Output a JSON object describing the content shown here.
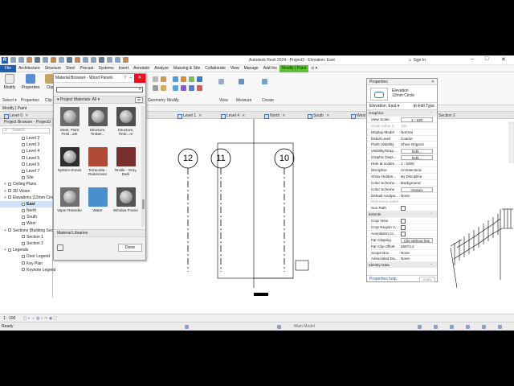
{
  "title_bar": {
    "app_title": "Autodesk Revit 2024 - Project3 - Elevation: East",
    "sign_in": "Sign In",
    "logo": "R"
  },
  "menu": {
    "tabs": [
      "File",
      "Architecture",
      "Structure",
      "Steel",
      "Precast",
      "Systems",
      "Insert",
      "Annotate",
      "Analyze",
      "Massing & Site",
      "Collaborate",
      "View",
      "Manage",
      "Add-Ins",
      "Modify | Paint"
    ]
  },
  "ribbon": {
    "modify_label": "Modify",
    "properties_label": "Properties",
    "select_label": "Select ▾",
    "clip_label": "Clip",
    "geometry_label": "Geometry",
    "panel_modify": "Modify",
    "panel_view": "View",
    "panel_measure": "Measure",
    "panel_create": "Create"
  },
  "modify_bar": "Modify | Paint",
  "view_tabs": [
    "Level 0",
    "Level 1",
    "Level 4",
    "North",
    "South",
    "West",
    "Section 2"
  ],
  "project_browser": {
    "title": "Project Browser - Project3",
    "search_placeholder": "Search",
    "items": [
      {
        "label": "Level 2",
        "type": "leaf"
      },
      {
        "label": "Level 3",
        "type": "leaf"
      },
      {
        "label": "Level 4",
        "type": "leaf"
      },
      {
        "label": "Level 5",
        "type": "leaf"
      },
      {
        "label": "Level 6",
        "type": "leaf"
      },
      {
        "label": "Level 7",
        "type": "leaf"
      },
      {
        "label": "Site",
        "type": "leaf"
      },
      {
        "label": "Ceiling Plans",
        "type": "group"
      },
      {
        "label": "3D Views",
        "type": "group"
      },
      {
        "label": "Elevations (12mm Circle)",
        "type": "group"
      },
      {
        "label": "East",
        "type": "leaf",
        "selected": true
      },
      {
        "label": "North",
        "type": "leaf"
      },
      {
        "label": "South",
        "type": "leaf"
      },
      {
        "label": "West",
        "type": "leaf"
      },
      {
        "label": "Sections (Building Section)",
        "type": "group"
      },
      {
        "label": "Section 1",
        "type": "leaf"
      },
      {
        "label": "Section 2",
        "type": "leaf"
      },
      {
        "label": "Legends",
        "type": "group"
      },
      {
        "label": "Door Legend",
        "type": "leaf"
      },
      {
        "label": "Key Plan",
        "type": "leaf"
      },
      {
        "label": "Keynote Legend",
        "type": "leaf"
      }
    ]
  },
  "material_browser": {
    "title": "Material Browser - Wood Panels",
    "help": "?",
    "search_value": "",
    "section_header": "Project Materials: All",
    "materials": [
      {
        "label": "Steel, Paint Finis...ark",
        "color": "#6a6a6a",
        "sphere": true
      },
      {
        "label": "Structure, Timber...",
        "color": "#5a5a5a",
        "sphere": true
      },
      {
        "label": "Structure, Timb...re",
        "color": "#4e4e4e",
        "sphere": true
      },
      {
        "label": "System-Zones",
        "color": "#2e2e2e",
        "sphere": true
      },
      {
        "label": "Terracotta - Rainscreen",
        "color": "#b04a34",
        "sphere": false
      },
      {
        "label": "Textile - Grey, Dark",
        "color": "#7a2f2f",
        "sphere": false
      },
      {
        "label": "Vapor Retarder",
        "color": "#707070",
        "sphere": true
      },
      {
        "label": "Water",
        "color": "#4a8fcc",
        "sphere": false
      },
      {
        "label": "Window Frame",
        "color": "#555555",
        "sphere": true
      },
      {
        "label": "",
        "color": "#d2a865",
        "sphere": false
      },
      {
        "label": "",
        "color": "#b98f5e",
        "sphere": false
      },
      {
        "label": "",
        "color": "#c9a46e",
        "sphere": false
      }
    ],
    "libraries_label": "Material Libraries",
    "done_label": "Done",
    "scroll_position": 0.85
  },
  "drawing": {
    "grid_labels": [
      "12",
      "11",
      "10"
    ]
  },
  "properties": {
    "title": "Properties",
    "type_name_line1": "Elevation",
    "type_name_line2": "12mm Circle",
    "selector": "Elevation: East",
    "edit_type": "Edit Type",
    "rows": [
      {
        "k": "Graphics",
        "v": "",
        "kind": "cat"
      },
      {
        "k": "View Scale",
        "v": "1 : 100",
        "kind": "box"
      },
      {
        "k": "Scale Value    1:",
        "v": "100",
        "kind": "grey"
      },
      {
        "k": "Display Model",
        "v": "Normal",
        "kind": "text"
      },
      {
        "k": "Detail Level",
        "v": "Coarse",
        "kind": "text"
      },
      {
        "k": "Parts Visibility",
        "v": "Show Original",
        "kind": "text"
      },
      {
        "k": "Visibility/Grap...",
        "v": "Edit...",
        "kind": "box"
      },
      {
        "k": "Graphic Displ...",
        "v": "Edit...",
        "kind": "box"
      },
      {
        "k": "Hide at scales ...",
        "v": "1 : 5000",
        "kind": "text"
      },
      {
        "k": "Discipline",
        "v": "Architectural",
        "kind": "text"
      },
      {
        "k": "Show Hidden...",
        "v": "By Discipline",
        "kind": "text"
      },
      {
        "k": "Color Scheme...",
        "v": "Background",
        "kind": "text"
      },
      {
        "k": "Color Scheme",
        "v": "<none>",
        "kind": "box"
      },
      {
        "k": "Default Analysi...",
        "v": "None",
        "kind": "text"
      },
      {
        "k": "Reference Label",
        "v": "",
        "kind": "grey"
      },
      {
        "k": "Sun Path",
        "v": "",
        "kind": "chk"
      },
      {
        "k": "Extents",
        "v": "",
        "kind": "cat"
      },
      {
        "k": "Crop View",
        "v": "",
        "kind": "chk"
      },
      {
        "k": "Crop Region V...",
        "v": "",
        "kind": "chk"
      },
      {
        "k": "Annotation Cr...",
        "v": "",
        "kind": "chk"
      },
      {
        "k": "Far Clipping",
        "v": "Clip without line",
        "kind": "box"
      },
      {
        "k": "Far Clip Offset",
        "v": "26874.2",
        "kind": "text"
      },
      {
        "k": "Scope Box",
        "v": "None",
        "kind": "text"
      },
      {
        "k": "Associated Da...",
        "v": "None",
        "kind": "text"
      },
      {
        "k": "Identity Data",
        "v": "",
        "kind": "cat"
      }
    ],
    "help_link": "Properties help",
    "apply": "Apply"
  },
  "view_control": {
    "scale": "1 : 100"
  },
  "status": {
    "ready": "Ready",
    "model": "Main Model"
  },
  "colors": {
    "accent_blue": "#1e5fb4",
    "context_tab_green": "#5cc433",
    "close_red": "#e81123"
  }
}
